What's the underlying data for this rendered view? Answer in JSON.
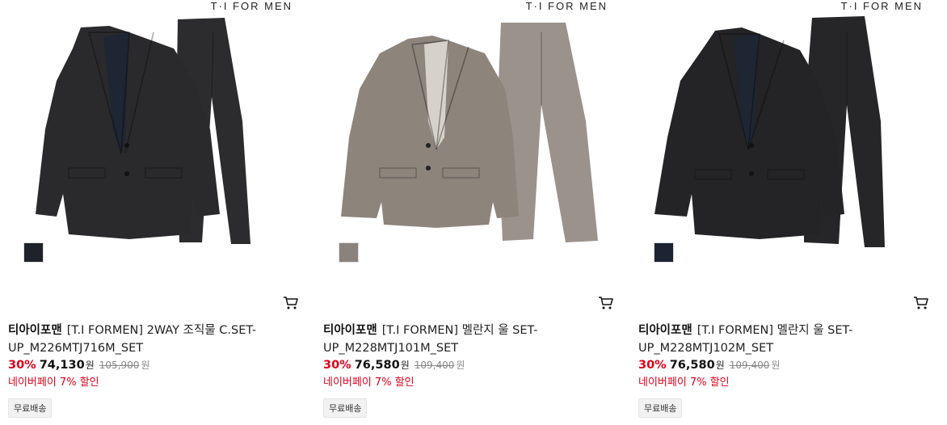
{
  "products": [
    {
      "watermark": "T·I FOR MEN",
      "swatch_color": "#1f2329",
      "jacket_color": "#2a2a2c",
      "pants_color": "#2c2c2e",
      "brand": "티아이포맨",
      "name": "[T.I FORMEN] 2WAY 조직물 C.SET-UP_M226MTJ716M_SET",
      "discount_rate": "30%",
      "price": "74,130",
      "price_unit": "원",
      "original_price": "105,900",
      "original_unit": "원",
      "npay_text": "네이버페이 7% 할인",
      "badge": "무료배송"
    },
    {
      "watermark": "T·I FOR MEN",
      "swatch_color": "#8a827d",
      "jacket_color": "#8d847c",
      "pants_color": "#9a928b",
      "brand": "티아이포맨",
      "name": "[T.I FORMEN] 멜란지 울 SET-UP_M228MTJ101M_SET",
      "discount_rate": "30%",
      "price": "76,580",
      "price_unit": "원",
      "original_price": "109,400",
      "original_unit": "원",
      "npay_text": "네이버페이 7% 할인",
      "badge": "무료배송"
    },
    {
      "watermark": "T·I FOR MEN",
      "swatch_color": "#1c2333",
      "jacket_color": "#242426",
      "pants_color": "#262628",
      "brand": "티아이포맨",
      "name": "[T.I FORMEN] 멜란지 울 SET-UP_M228MTJ102M_SET",
      "discount_rate": "30%",
      "price": "76,580",
      "price_unit": "원",
      "original_price": "109,400",
      "original_unit": "원",
      "npay_text": "네이버페이 7% 할인",
      "badge": "무료배송"
    }
  ],
  "icons": {
    "cart": "cart-icon"
  }
}
